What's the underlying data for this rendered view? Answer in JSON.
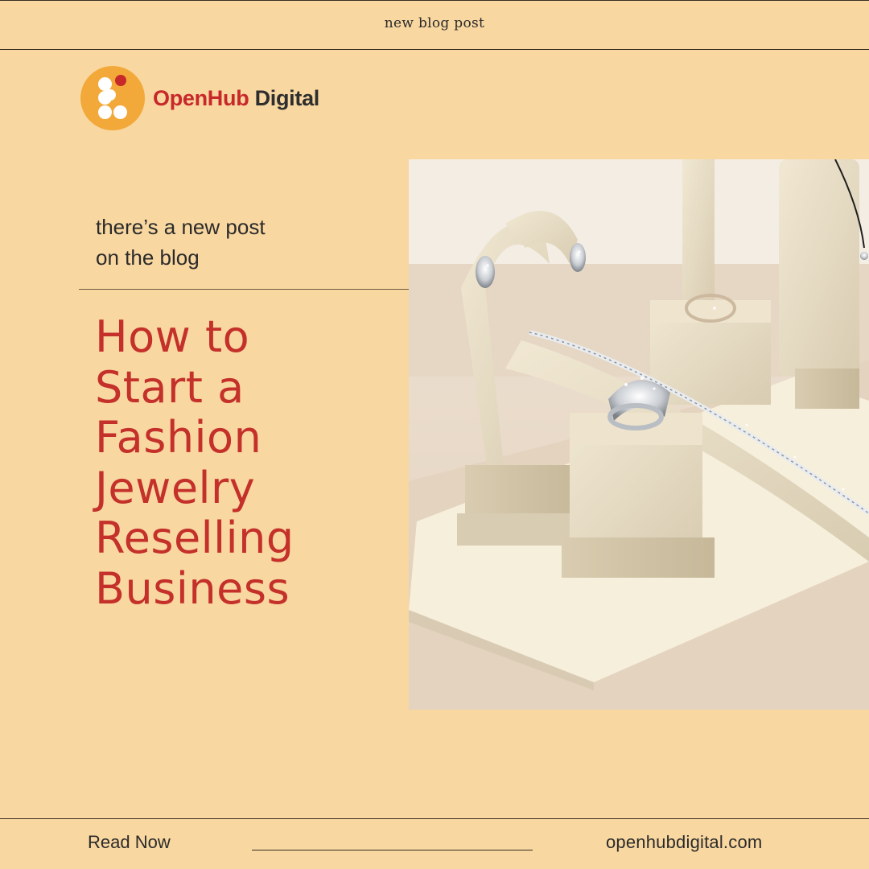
{
  "header": {
    "tagline": "new blog post"
  },
  "brand": {
    "name_part1": "OpenHub",
    "name_part2": " Digital",
    "accent": "#c7282a",
    "logo_bg": "#f2a93a"
  },
  "intro": {
    "line1": "there’s a new post",
    "line2": "on the blog"
  },
  "headline": {
    "lines": [
      "How to",
      "Start a",
      "Fashion",
      "Jewelry",
      "Reselling",
      "Business"
    ],
    "color": "#c4302a"
  },
  "photo": {
    "subject": "jewelry-display-photo"
  },
  "footer": {
    "cta": "Read Now",
    "website": "openhubdigital.com"
  },
  "colors": {
    "background": "#f9d7a0",
    "text": "#2b2b2b"
  }
}
